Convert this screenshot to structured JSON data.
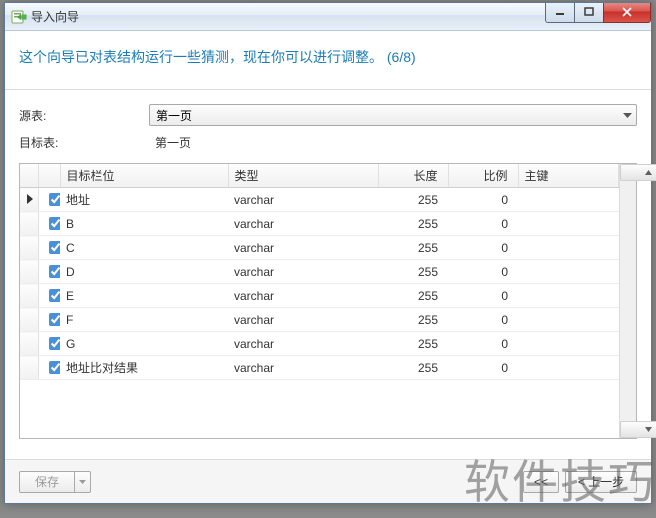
{
  "window": {
    "title": "导入向导"
  },
  "header": {
    "message": "这个向导已对表结构运行一些猜测，现在你可以进行调整。 (6/8)"
  },
  "form": {
    "source_label": "源表:",
    "source_value": "第一页",
    "target_label": "目标表:",
    "target_value": "第一页"
  },
  "grid": {
    "columns": {
      "field": "目标栏位",
      "type": "类型",
      "length": "长度",
      "scale": "比例",
      "pk": "主键"
    },
    "rows": [
      {
        "selected": true,
        "current": true,
        "field": "地址",
        "type": "varchar",
        "length": 255,
        "scale": 0
      },
      {
        "selected": true,
        "current": false,
        "field": "B",
        "type": "varchar",
        "length": 255,
        "scale": 0
      },
      {
        "selected": true,
        "current": false,
        "field": "C",
        "type": "varchar",
        "length": 255,
        "scale": 0
      },
      {
        "selected": true,
        "current": false,
        "field": "D",
        "type": "varchar",
        "length": 255,
        "scale": 0
      },
      {
        "selected": true,
        "current": false,
        "field": "E",
        "type": "varchar",
        "length": 255,
        "scale": 0
      },
      {
        "selected": true,
        "current": false,
        "field": "F",
        "type": "varchar",
        "length": 255,
        "scale": 0
      },
      {
        "selected": true,
        "current": false,
        "field": "G",
        "type": "varchar",
        "length": 255,
        "scale": 0
      },
      {
        "selected": true,
        "current": false,
        "field": "地址比对结果",
        "type": "varchar",
        "length": 255,
        "scale": 0
      }
    ]
  },
  "footer": {
    "save": "保存",
    "first": "<<",
    "prev": "< 上一步"
  },
  "watermark": "软件技巧"
}
